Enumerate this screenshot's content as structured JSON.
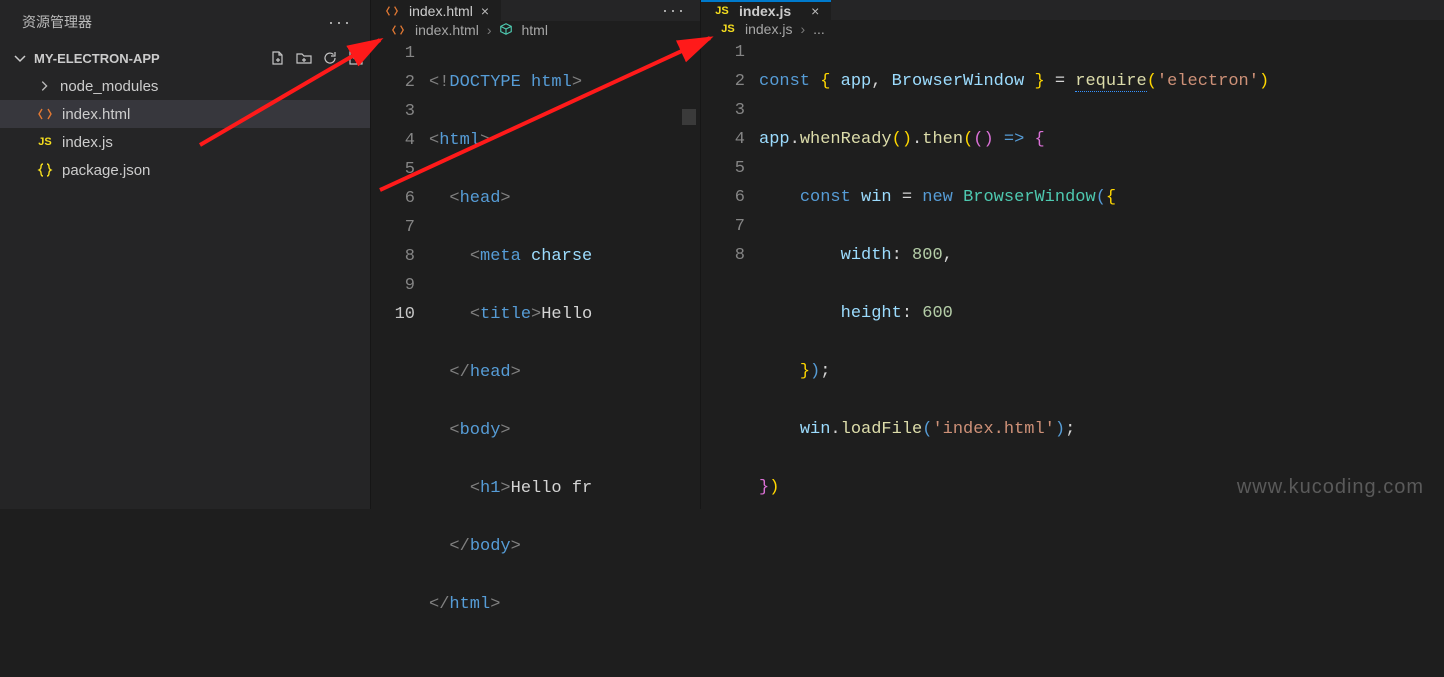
{
  "sidebar": {
    "title": "资源管理器",
    "project": "MY-ELECTRON-APP",
    "items": [
      {
        "label": "node_modules",
        "icon": "folder"
      },
      {
        "label": "index.html",
        "icon": "html"
      },
      {
        "label": "index.js",
        "icon": "js"
      },
      {
        "label": "package.json",
        "icon": "json"
      }
    ]
  },
  "editor_left": {
    "tab_label": "index.html",
    "breadcrumb": {
      "file": "index.html",
      "symbol": "html"
    },
    "lines": [
      "1",
      "2",
      "3",
      "4",
      "5",
      "6",
      "7",
      "8",
      "9",
      "10"
    ],
    "code": {
      "l1_doctype": "DOCTYPE",
      "l1_html": "html",
      "l2_tag": "html",
      "l3_tag": "head",
      "l4_tag": "meta",
      "l4_attr": "charse",
      "l5_tag": "title",
      "l5_text": "Hello",
      "l6_tag": "head",
      "l7_tag": "body",
      "l8_tag": "h1",
      "l8_text": "Hello fr",
      "l9_tag": "body",
      "l10_tag": "html"
    }
  },
  "editor_right": {
    "tab_label": "index.js",
    "breadcrumb": {
      "file": "index.js",
      "rest": "..."
    },
    "lines": [
      "1",
      "2",
      "3",
      "4",
      "5",
      "6",
      "7",
      "8"
    ],
    "code": {
      "const": "const",
      "app": "app",
      "BrowserWindow": "BrowserWindow",
      "require": "require",
      "electron": "'electron'",
      "whenReady": "whenReady",
      "then": "then",
      "win": "win",
      "new": "new",
      "width": "width",
      "w": "800",
      "height": "height",
      "h": "600",
      "loadFile": "loadFile",
      "file": "'index.html'"
    }
  },
  "watermark": "www.kucoding.com"
}
